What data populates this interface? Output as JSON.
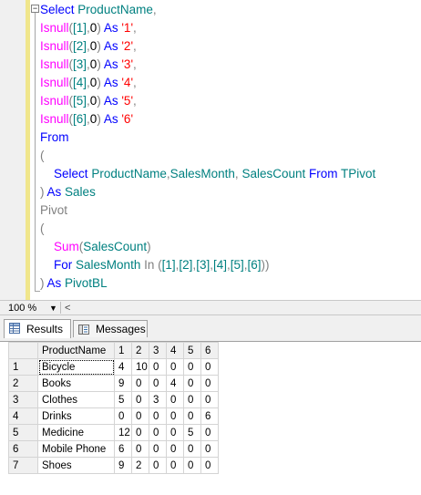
{
  "editor": {
    "lines": [
      [
        {
          "t": "Select",
          "c": "kw"
        },
        {
          "t": " ",
          "c": "pl"
        },
        {
          "t": "ProductName",
          "c": "ident"
        },
        {
          "t": ",",
          "c": "gray"
        }
      ],
      [
        {
          "t": "Isnull",
          "c": "fn"
        },
        {
          "t": "(",
          "c": "gray"
        },
        {
          "t": "[1]",
          "c": "ident"
        },
        {
          "t": ",",
          "c": "gray"
        },
        {
          "t": "0",
          "c": "pl"
        },
        {
          "t": ")",
          "c": "gray"
        },
        {
          "t": " ",
          "c": "pl"
        },
        {
          "t": "As",
          "c": "kw"
        },
        {
          "t": " ",
          "c": "pl"
        },
        {
          "t": "'1'",
          "c": "str"
        },
        {
          "t": ",",
          "c": "gray"
        }
      ],
      [
        {
          "t": "Isnull",
          "c": "fn"
        },
        {
          "t": "(",
          "c": "gray"
        },
        {
          "t": "[2]",
          "c": "ident"
        },
        {
          "t": ",",
          "c": "gray"
        },
        {
          "t": "0",
          "c": "pl"
        },
        {
          "t": ")",
          "c": "gray"
        },
        {
          "t": " ",
          "c": "pl"
        },
        {
          "t": "As",
          "c": "kw"
        },
        {
          "t": " ",
          "c": "pl"
        },
        {
          "t": "'2'",
          "c": "str"
        },
        {
          "t": ",",
          "c": "gray"
        }
      ],
      [
        {
          "t": "Isnull",
          "c": "fn"
        },
        {
          "t": "(",
          "c": "gray"
        },
        {
          "t": "[3]",
          "c": "ident"
        },
        {
          "t": ",",
          "c": "gray"
        },
        {
          "t": "0",
          "c": "pl"
        },
        {
          "t": ")",
          "c": "gray"
        },
        {
          "t": " ",
          "c": "pl"
        },
        {
          "t": "As",
          "c": "kw"
        },
        {
          "t": " ",
          "c": "pl"
        },
        {
          "t": "'3'",
          "c": "str"
        },
        {
          "t": ",",
          "c": "gray"
        }
      ],
      [
        {
          "t": "Isnull",
          "c": "fn"
        },
        {
          "t": "(",
          "c": "gray"
        },
        {
          "t": "[4]",
          "c": "ident"
        },
        {
          "t": ",",
          "c": "gray"
        },
        {
          "t": "0",
          "c": "pl"
        },
        {
          "t": ")",
          "c": "gray"
        },
        {
          "t": " ",
          "c": "pl"
        },
        {
          "t": "As",
          "c": "kw"
        },
        {
          "t": " ",
          "c": "pl"
        },
        {
          "t": "'4'",
          "c": "str"
        },
        {
          "t": ",",
          "c": "gray"
        }
      ],
      [
        {
          "t": "Isnull",
          "c": "fn"
        },
        {
          "t": "(",
          "c": "gray"
        },
        {
          "t": "[5]",
          "c": "ident"
        },
        {
          "t": ",",
          "c": "gray"
        },
        {
          "t": "0",
          "c": "pl"
        },
        {
          "t": ")",
          "c": "gray"
        },
        {
          "t": " ",
          "c": "pl"
        },
        {
          "t": "As",
          "c": "kw"
        },
        {
          "t": " ",
          "c": "pl"
        },
        {
          "t": "'5'",
          "c": "str"
        },
        {
          "t": ",",
          "c": "gray"
        }
      ],
      [
        {
          "t": "Isnull",
          "c": "fn"
        },
        {
          "t": "(",
          "c": "gray"
        },
        {
          "t": "[6]",
          "c": "ident"
        },
        {
          "t": ",",
          "c": "gray"
        },
        {
          "t": "0",
          "c": "pl"
        },
        {
          "t": ")",
          "c": "gray"
        },
        {
          "t": " ",
          "c": "pl"
        },
        {
          "t": "As",
          "c": "kw"
        },
        {
          "t": " ",
          "c": "pl"
        },
        {
          "t": "'6'",
          "c": "str"
        }
      ],
      [
        {
          "t": "From",
          "c": "kw"
        }
      ],
      [
        {
          "t": "(",
          "c": "gray"
        }
      ],
      [
        {
          "t": "    ",
          "c": "pl"
        },
        {
          "t": "Select",
          "c": "kw"
        },
        {
          "t": " ",
          "c": "pl"
        },
        {
          "t": "ProductName",
          "c": "ident"
        },
        {
          "t": ",",
          "c": "gray"
        },
        {
          "t": "SalesMonth",
          "c": "ident"
        },
        {
          "t": ",",
          "c": "gray"
        },
        {
          "t": " ",
          "c": "pl"
        },
        {
          "t": "SalesCount",
          "c": "ident"
        },
        {
          "t": " ",
          "c": "pl"
        },
        {
          "t": "From",
          "c": "kw"
        },
        {
          "t": " ",
          "c": "pl"
        },
        {
          "t": "TPivot",
          "c": "ident"
        }
      ],
      [
        {
          "t": ")",
          "c": "gray"
        },
        {
          "t": " ",
          "c": "pl"
        },
        {
          "t": "As",
          "c": "kw"
        },
        {
          "t": " ",
          "c": "pl"
        },
        {
          "t": "Sales",
          "c": "ident"
        }
      ],
      [
        {
          "t": "Pivot",
          "c": "gray"
        }
      ],
      [
        {
          "t": "(",
          "c": "gray"
        }
      ],
      [
        {
          "t": "    ",
          "c": "pl"
        },
        {
          "t": "Sum",
          "c": "fn"
        },
        {
          "t": "(",
          "c": "gray"
        },
        {
          "t": "SalesCount",
          "c": "ident"
        },
        {
          "t": ")",
          "c": "gray"
        }
      ],
      [
        {
          "t": "    ",
          "c": "pl"
        },
        {
          "t": "For",
          "c": "kw"
        },
        {
          "t": " ",
          "c": "pl"
        },
        {
          "t": "SalesMonth",
          "c": "ident"
        },
        {
          "t": " ",
          "c": "pl"
        },
        {
          "t": "In",
          "c": "gray"
        },
        {
          "t": " ",
          "c": "pl"
        },
        {
          "t": "(",
          "c": "gray"
        },
        {
          "t": "[1]",
          "c": "ident"
        },
        {
          "t": ",",
          "c": "gray"
        },
        {
          "t": "[2]",
          "c": "ident"
        },
        {
          "t": ",",
          "c": "gray"
        },
        {
          "t": "[3]",
          "c": "ident"
        },
        {
          "t": ",",
          "c": "gray"
        },
        {
          "t": "[4]",
          "c": "ident"
        },
        {
          "t": ",",
          "c": "gray"
        },
        {
          "t": "[5]",
          "c": "ident"
        },
        {
          "t": ",",
          "c": "gray"
        },
        {
          "t": "[6]",
          "c": "ident"
        },
        {
          "t": "))",
          "c": "gray"
        }
      ],
      [
        {
          "t": ")",
          "c": "gray"
        },
        {
          "t": " ",
          "c": "pl"
        },
        {
          "t": "As",
          "c": "kw"
        },
        {
          "t": " ",
          "c": "pl"
        },
        {
          "t": "PivotBL",
          "c": "ident"
        }
      ]
    ],
    "colors": {
      "keyword": "#0000ff",
      "function": "#ff00ff",
      "identifier": "#008080",
      "string": "#ff0000",
      "operator": "#808080"
    }
  },
  "statusbar": {
    "zoom": "100 %",
    "zoom_dropdown_icon": "chevron-down-icon",
    "scroll_left_icon": "chevron-left-icon",
    "scroll_left_glyph": "<"
  },
  "tabs": [
    {
      "label": "Results",
      "icon": "grid-icon",
      "active": true
    },
    {
      "label": "Messages",
      "icon": "messages-icon",
      "active": false
    }
  ],
  "results": {
    "columns": [
      "ProductName",
      "1",
      "2",
      "3",
      "4",
      "5",
      "6"
    ],
    "rows": [
      {
        "n": "1",
        "cells": [
          "Bicycle",
          "4",
          "10",
          "0",
          "0",
          "0",
          "0"
        ]
      },
      {
        "n": "2",
        "cells": [
          "Books",
          "9",
          "0",
          "0",
          "4",
          "0",
          "0"
        ]
      },
      {
        "n": "3",
        "cells": [
          "Clothes",
          "5",
          "0",
          "3",
          "0",
          "0",
          "0"
        ]
      },
      {
        "n": "4",
        "cells": [
          "Drinks",
          "0",
          "0",
          "0",
          "0",
          "0",
          "6"
        ]
      },
      {
        "n": "5",
        "cells": [
          "Medicine",
          "12",
          "0",
          "0",
          "0",
          "5",
          "0"
        ]
      },
      {
        "n": "6",
        "cells": [
          "Mobile Phone",
          "6",
          "0",
          "0",
          "0",
          "0",
          "0"
        ]
      },
      {
        "n": "7",
        "cells": [
          "Shoes",
          "9",
          "2",
          "0",
          "0",
          "0",
          "0"
        ]
      }
    ],
    "selected_cell": "Bicycle"
  }
}
